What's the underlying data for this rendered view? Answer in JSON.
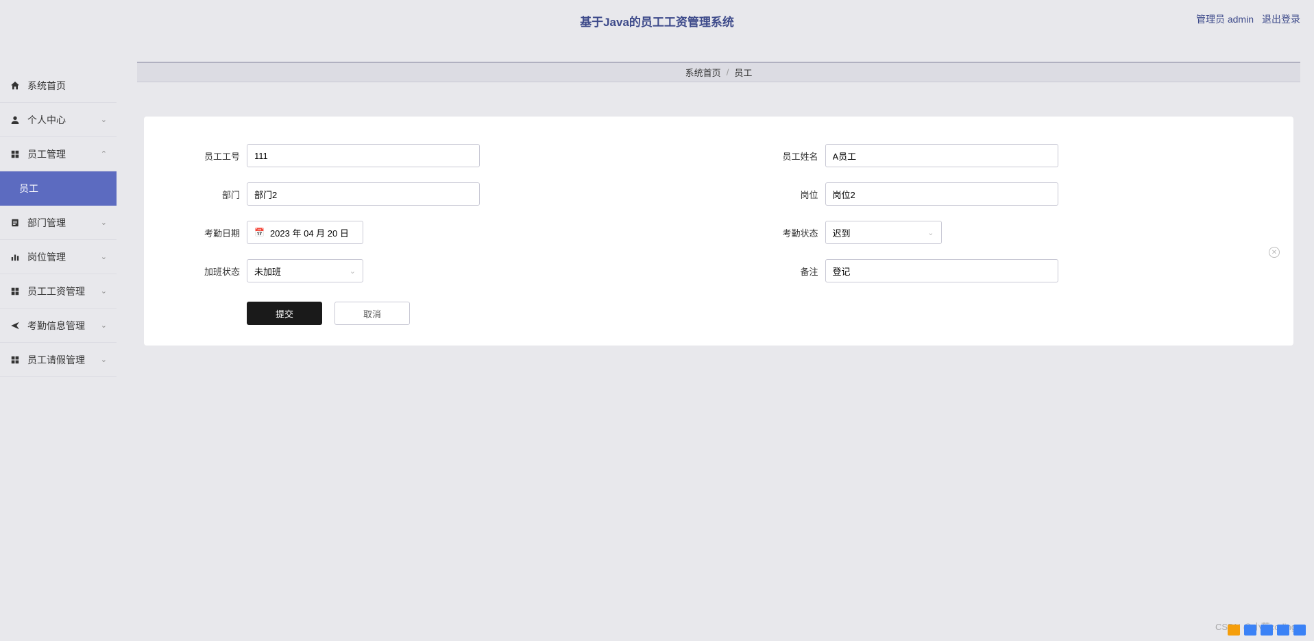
{
  "header": {
    "title": "基于Java的员工工资管理系统",
    "admin_label": "管理员 admin",
    "logout_label": "退出登录"
  },
  "sidebar": {
    "items": [
      {
        "label": "系统首页",
        "icon": "home",
        "expandable": false
      },
      {
        "label": "个人中心",
        "icon": "person",
        "expandable": true
      },
      {
        "label": "员工管理",
        "icon": "grid",
        "expandable": true,
        "expanded": true
      },
      {
        "label": "员工",
        "icon": "",
        "active": true
      },
      {
        "label": "部门管理",
        "icon": "document",
        "expandable": true
      },
      {
        "label": "岗位管理",
        "icon": "bars",
        "expandable": true
      },
      {
        "label": "员工工资管理",
        "icon": "grid",
        "expandable": true
      },
      {
        "label": "考勤信息管理",
        "icon": "send",
        "expandable": true
      },
      {
        "label": "员工请假管理",
        "icon": "grid",
        "expandable": true
      }
    ]
  },
  "breadcrumb": {
    "home": "系统首页",
    "current": "员工"
  },
  "form": {
    "employee_id_label": "员工工号",
    "employee_id_value": "111",
    "employee_name_label": "员工姓名",
    "employee_name_value": "A员工",
    "department_label": "部门",
    "department_value": "部门2",
    "position_label": "岗位",
    "position_value": "岗位2",
    "attendance_date_label": "考勤日期",
    "attendance_date_value": "2023 年 04 月 20 日",
    "attendance_status_label": "考勤状态",
    "attendance_status_value": "迟到",
    "overtime_status_label": "加班状态",
    "overtime_status_value": "未加班",
    "remark_label": "备注",
    "remark_value": "登记",
    "submit_label": "提交",
    "cancel_label": "取消"
  },
  "watermark": "CSDN @小蔡coding"
}
